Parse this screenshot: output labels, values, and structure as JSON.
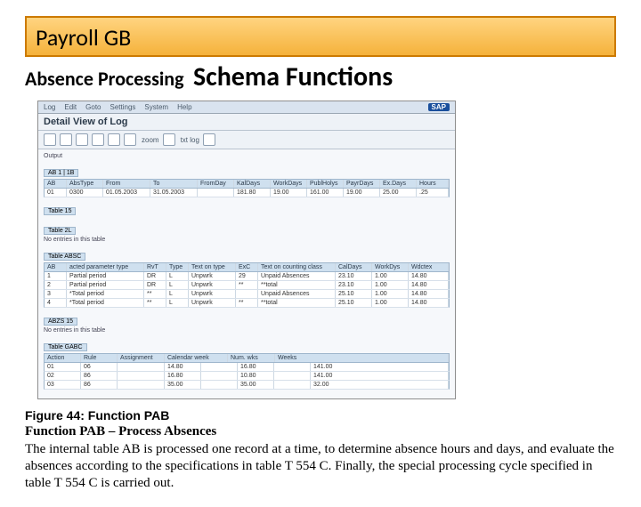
{
  "title": "Payroll GB",
  "subtitle_a": "Absence Processing",
  "subtitle_b": "Schema Functions",
  "figure_caption": "Figure 44: Function PAB",
  "figure_subcaption": "Function PAB – Process Absences",
  "body": "The internal table AB is processed one record at a time, to determine absence hours and days, and evaluate the absences according to the specifications in table T 554 C. Finally, the special processing cycle specified in table T 554 C is carried out.",
  "sap": {
    "menu": [
      "Log",
      "Edit",
      "Goto",
      "Settings",
      "System",
      "Help"
    ],
    "logo": "SAP",
    "window_title": "Detail View of Log",
    "toolbar": {
      "zoom": "zoom",
      "txtlog": "txt log"
    },
    "output_label": "Output",
    "ab_tag": "AB 1 | 1B",
    "ab_headers": [
      "AB",
      "AbsType",
      "From",
      "To",
      "FromDay",
      "KalDays",
      "WorkDays",
      "PublHolys",
      "PayrDays",
      "Ex.Days",
      "Hours"
    ],
    "ab_row": [
      "01",
      "0300",
      "01.05.2003",
      "31.05.2003",
      "",
      "181.80",
      "19.00",
      "161.00",
      "19.00",
      "25.00",
      ".25"
    ],
    "table15_label": "Table 15",
    "table2l": {
      "label": "Table 2L",
      "note": "No entries in this table"
    },
    "table_absc": {
      "label": "Table ABSC",
      "headers": [
        "AB",
        "acted parameter type",
        "RvT",
        "Type",
        "Text on type",
        "ExC",
        "Text on counting class",
        "CalDays",
        "WorkDys",
        "Wdctex"
      ],
      "rows": [
        [
          "1",
          "Partial period",
          "DR",
          "L",
          "Unpwrk",
          "29",
          "Unpaid Absences",
          "23.10",
          "1.00",
          "14.80"
        ],
        [
          "2",
          "Partial period",
          "DR",
          "L",
          "Unpwrk",
          "**",
          "**total",
          "23.10",
          "1.00",
          "14.80"
        ],
        [
          "3",
          "*Total period",
          "**",
          "L",
          "Unpwrk",
          "",
          "Unpaid Absences",
          "25.10",
          "1.00",
          "14.80"
        ],
        [
          "4",
          "*Total period",
          "**",
          "L",
          "Unpwrk",
          "**",
          "**total",
          "25.10",
          "1.00",
          "14.80"
        ]
      ]
    },
    "abzs": {
      "label": "ABZS 15",
      "note": "No entries in this table"
    },
    "gabc": {
      "label": "Table GABC",
      "headers": [
        "Action",
        "Rule",
        "Assignment",
        "Calendar week",
        "Num. wks",
        "Weeks"
      ],
      "rows": [
        [
          "01",
          "06",
          "",
          "14.80",
          "",
          "16.80",
          "",
          "141.00"
        ],
        [
          "02",
          "86",
          "",
          "16.80",
          "",
          "10.80",
          "",
          "141.00"
        ],
        [
          "03",
          "86",
          "",
          "35.00",
          "",
          "35.00",
          "",
          "32.00"
        ]
      ]
    }
  }
}
